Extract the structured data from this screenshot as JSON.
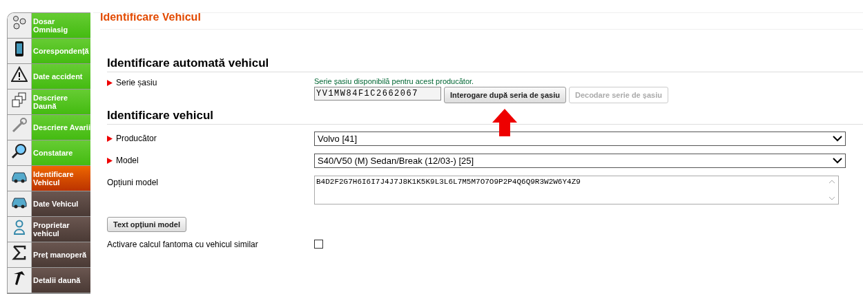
{
  "sidebar": {
    "items": [
      {
        "label": "Dosar Omniasig",
        "done": true,
        "selected": false
      },
      {
        "label": "Corespondență",
        "done": true,
        "selected": false
      },
      {
        "label": "Date accident",
        "done": true,
        "selected": false
      },
      {
        "label": "Descriere Daună",
        "done": true,
        "selected": false
      },
      {
        "label": "Descriere Avarii",
        "done": true,
        "selected": false
      },
      {
        "label": "Constatare",
        "done": true,
        "selected": false
      },
      {
        "label": "Identificare Vehicul",
        "done": false,
        "selected": true
      },
      {
        "label": "Date Vehicul",
        "done": false,
        "selected": false
      },
      {
        "label": "Proprietar vehicul",
        "done": false,
        "selected": false
      },
      {
        "label": "Preț manoperă",
        "done": false,
        "selected": false
      },
      {
        "label": "Detalii daună",
        "done": false,
        "selected": false
      }
    ]
  },
  "page_title": "Identificare Vehicul",
  "auto_section": {
    "heading": "Identificare automată vehicul",
    "chassis": {
      "label": "Serie șasiu",
      "required": true,
      "hint": "Serie șasiu disponibilă pentru acest producător.",
      "value": "YV1MW84F1C2662067"
    },
    "buttons": [
      {
        "label": "Interogare după seria de șasiu",
        "disabled": false,
        "highlighted": true
      },
      {
        "label": "Decodare serie de șasiu",
        "disabled": true,
        "highlighted": false
      }
    ]
  },
  "vehicle_section": {
    "heading": "Identificare vehicul",
    "producer": {
      "label": "Producător",
      "required": true,
      "value": "Volvo [41]"
    },
    "model": {
      "label": "Model",
      "required": true,
      "value": "S40/V50 (M) Sedan/Break (12/03-) [25]"
    },
    "model_options": {
      "label": "Opțiuni model",
      "required": false,
      "value": "B4D2F2G7H6I6I7J4J7J8K1K5K9L3L6L7M5M7O7O9P2P4Q6Q9R3W2W6Y4Z9"
    },
    "options_button": "Text opțiuni model",
    "phantom": {
      "label": "Activare calcul fantoma cu vehicul similar",
      "checked": false
    }
  }
}
